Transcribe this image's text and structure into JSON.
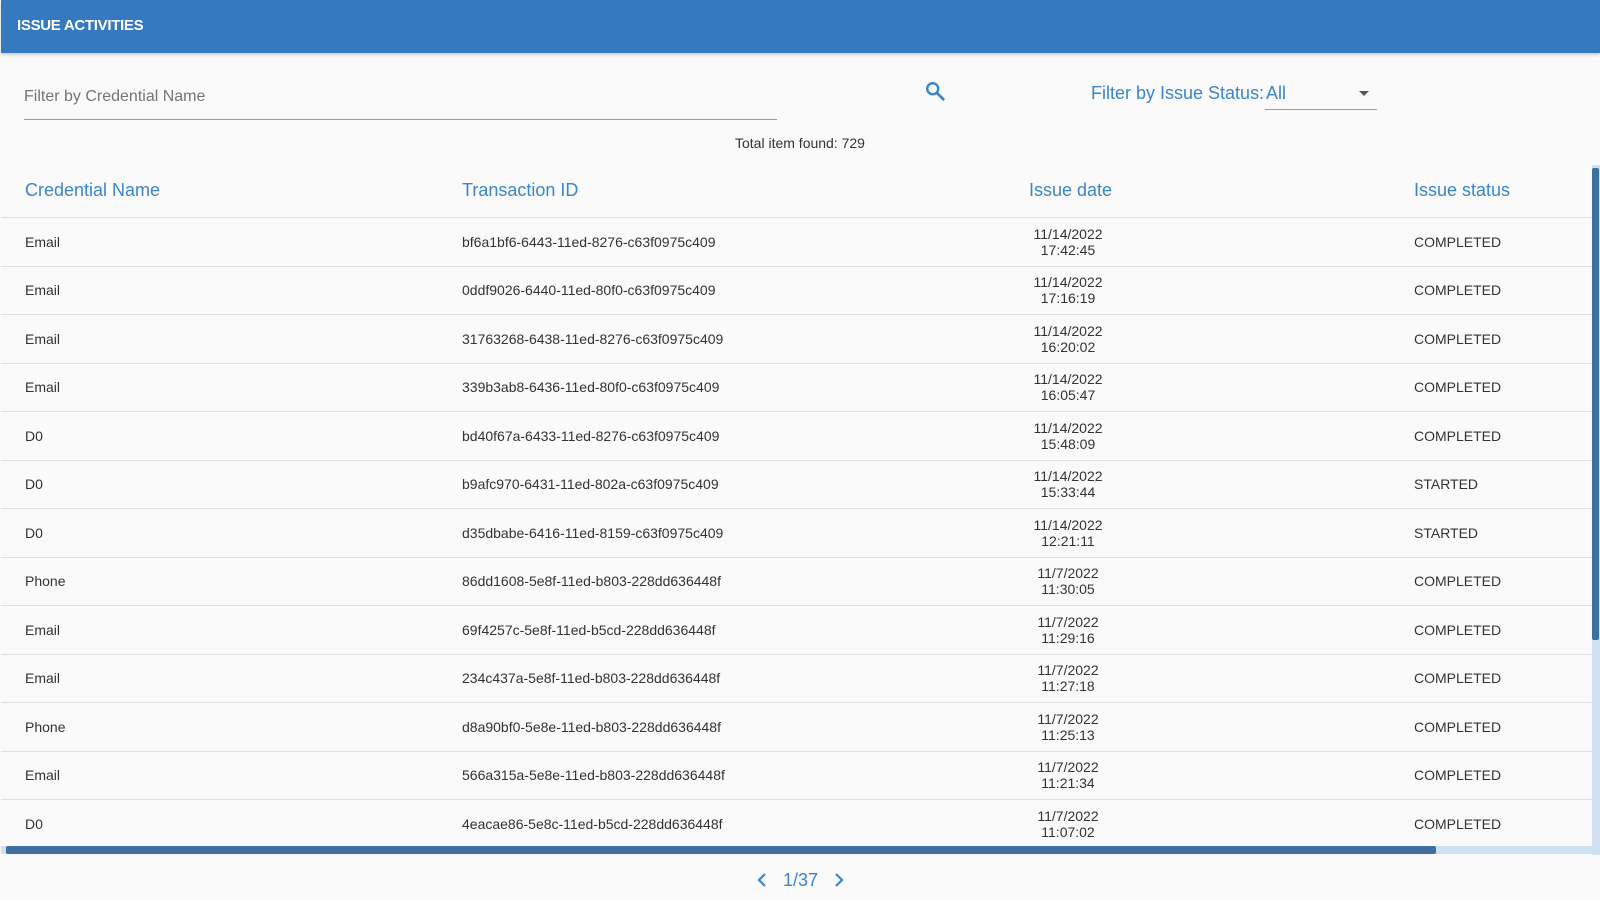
{
  "header": {
    "title": "ISSUE ACTIVITIES",
    "bg_color": "#357ac0"
  },
  "filters": {
    "credential_placeholder": "Filter by Credential Name",
    "credential_value": "",
    "status_label": "Filter by Issue Status:",
    "status_value": "All"
  },
  "total_label": "Total item found: 729",
  "table": {
    "columns": [
      "Credential Name",
      "Transaction ID",
      "Issue date",
      "Issue status"
    ],
    "rows": [
      {
        "name": "Email",
        "txid": "bf6a1bf6-6443-11ed-8276-c63f0975c409",
        "date": "11/14/2022",
        "time": "17:42:45",
        "status": "COMPLETED"
      },
      {
        "name": "Email",
        "txid": "0ddf9026-6440-11ed-80f0-c63f0975c409",
        "date": "11/14/2022",
        "time": "17:16:19",
        "status": "COMPLETED"
      },
      {
        "name": "Email",
        "txid": "31763268-6438-11ed-8276-c63f0975c409",
        "date": "11/14/2022",
        "time": "16:20:02",
        "status": "COMPLETED"
      },
      {
        "name": "Email",
        "txid": "339b3ab8-6436-11ed-80f0-c63f0975c409",
        "date": "11/14/2022",
        "time": "16:05:47",
        "status": "COMPLETED"
      },
      {
        "name": "D0",
        "txid": "bd40f67a-6433-11ed-8276-c63f0975c409",
        "date": "11/14/2022",
        "time": "15:48:09",
        "status": "COMPLETED"
      },
      {
        "name": "D0",
        "txid": "b9afc970-6431-11ed-802a-c63f0975c409",
        "date": "11/14/2022",
        "time": "15:33:44",
        "status": "STARTED"
      },
      {
        "name": "D0",
        "txid": "d35dbabe-6416-11ed-8159-c63f0975c409",
        "date": "11/14/2022",
        "time": "12:21:11",
        "status": "STARTED"
      },
      {
        "name": "Phone",
        "txid": "86dd1608-5e8f-11ed-b803-228dd636448f",
        "date": "11/7/2022",
        "time": "11:30:05",
        "status": "COMPLETED"
      },
      {
        "name": "Email",
        "txid": "69f4257c-5e8f-11ed-b5cd-228dd636448f",
        "date": "11/7/2022",
        "time": "11:29:16",
        "status": "COMPLETED"
      },
      {
        "name": "Email",
        "txid": "234c437a-5e8f-11ed-b803-228dd636448f",
        "date": "11/7/2022",
        "time": "11:27:18",
        "status": "COMPLETED"
      },
      {
        "name": "Phone",
        "txid": "d8a90bf0-5e8e-11ed-b803-228dd636448f",
        "date": "11/7/2022",
        "time": "11:25:13",
        "status": "COMPLETED"
      },
      {
        "name": "Email",
        "txid": "566a315a-5e8e-11ed-b803-228dd636448f",
        "date": "11/7/2022",
        "time": "11:21:34",
        "status": "COMPLETED"
      },
      {
        "name": "D0",
        "txid": "4eacae86-5e8c-11ed-b5cd-228dd636448f",
        "date": "11/7/2022",
        "time": "11:07:02",
        "status": "COMPLETED"
      }
    ]
  },
  "pagination": {
    "label": "1/37"
  },
  "icons": {
    "search": "search-icon",
    "prev": "chevron-left-icon",
    "next": "chevron-right-icon",
    "dropdown": "caret-down-icon"
  },
  "colors": {
    "accent": "#3a85cc",
    "scrollbar_thumb": "#3f6fa0"
  }
}
